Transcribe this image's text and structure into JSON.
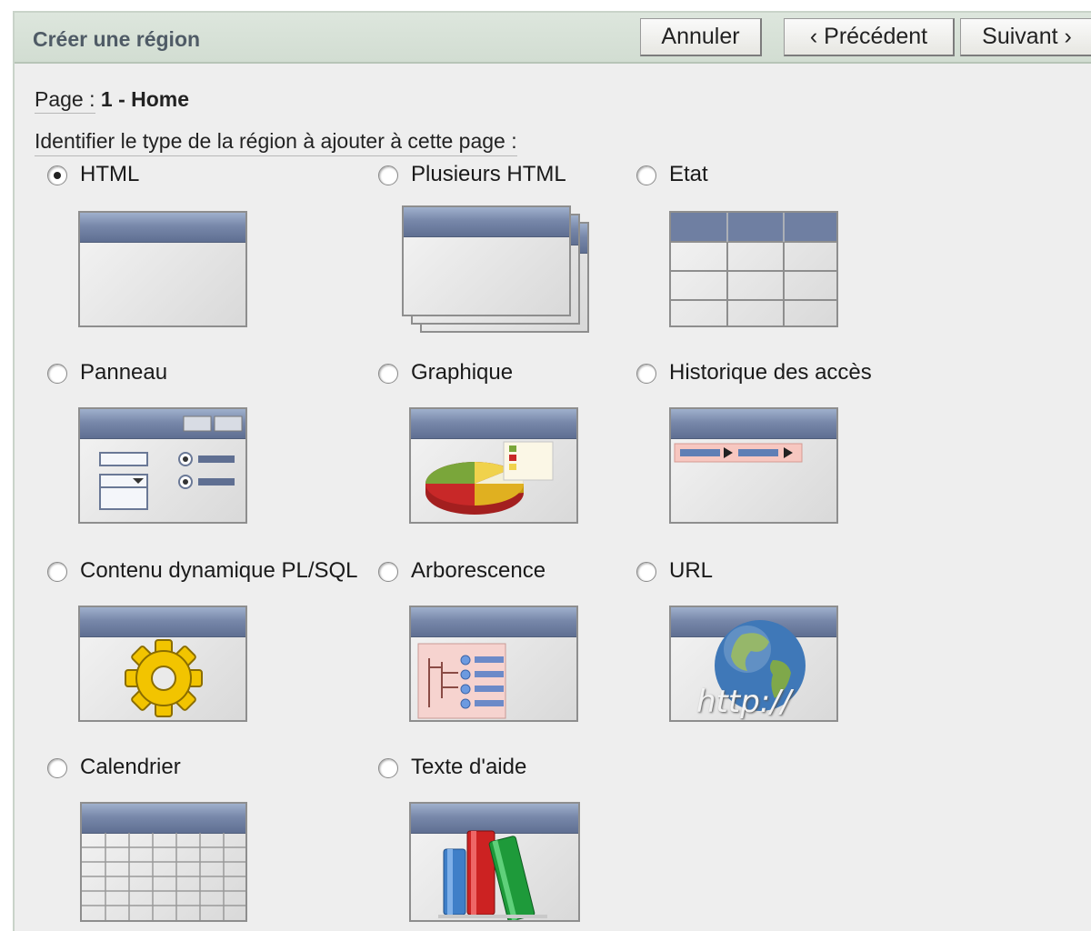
{
  "header": {
    "title": "Créer une région",
    "cancel_label": "Annuler",
    "prev_label": "‹ Précédent",
    "next_label": "Suivant ›"
  },
  "page": {
    "label": "Page :",
    "value": "1 - Home"
  },
  "prompt": "Identifier le type de la région à ajouter à cette page :",
  "selected": "HTML",
  "options": [
    {
      "label": "HTML",
      "icon": "html-region-icon",
      "checked": true
    },
    {
      "label": "Plusieurs HTML",
      "icon": "multiple-html-icon",
      "checked": false
    },
    {
      "label": "Etat",
      "icon": "report-table-icon",
      "checked": false
    },
    {
      "label": "Panneau",
      "icon": "form-panel-icon",
      "checked": false
    },
    {
      "label": "Graphique",
      "icon": "pie-chart-icon",
      "checked": false
    },
    {
      "label": "Historique des accès",
      "icon": "breadcrumb-icon",
      "checked": false
    },
    {
      "label": "Contenu dynamique PL/SQL",
      "icon": "gear-icon",
      "checked": false
    },
    {
      "label": "Arborescence",
      "icon": "tree-icon",
      "checked": false
    },
    {
      "label": "URL",
      "icon": "globe-url-icon",
      "checked": false
    },
    {
      "label": "Calendrier",
      "icon": "calendar-grid-icon",
      "checked": false
    },
    {
      "label": "Texte d'aide",
      "icon": "books-icon",
      "checked": false
    }
  ],
  "url_icon_text": "http://",
  "colors": {
    "header_bg": "#d2ddd2",
    "panel_bg": "#eeeeee",
    "title_bar": "#7888aa"
  }
}
